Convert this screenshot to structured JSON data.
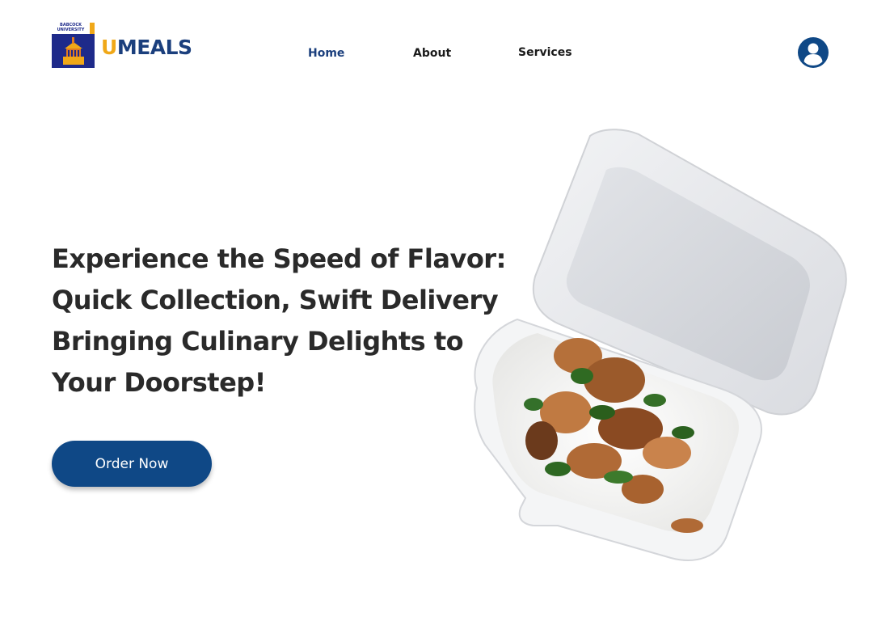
{
  "header": {
    "logo": {
      "university_text": "BABCOCK UNIVERSITY",
      "colors": {
        "navy": "#1e2a8a",
        "gold": "#f0a818"
      }
    },
    "brand": {
      "first_letter": "U",
      "rest": "MEALS",
      "colors": {
        "first_letter": "#f0a818",
        "rest": "#1b3f7d"
      }
    },
    "nav": {
      "home": "Home",
      "about": "About",
      "services": "Services",
      "active": "Home"
    },
    "user_icon": "user-circle-icon"
  },
  "hero": {
    "headline_lines": [
      "Experience the Speed of Flavor:",
      "Quick Collection, Swift Delivery",
      "Bringing Culinary Delights to",
      "Your Doorstep!"
    ],
    "cta_label": "Order Now",
    "cta_color": "#0f4886",
    "image": "styrofoam-food-box-with-rice-and-meat"
  }
}
